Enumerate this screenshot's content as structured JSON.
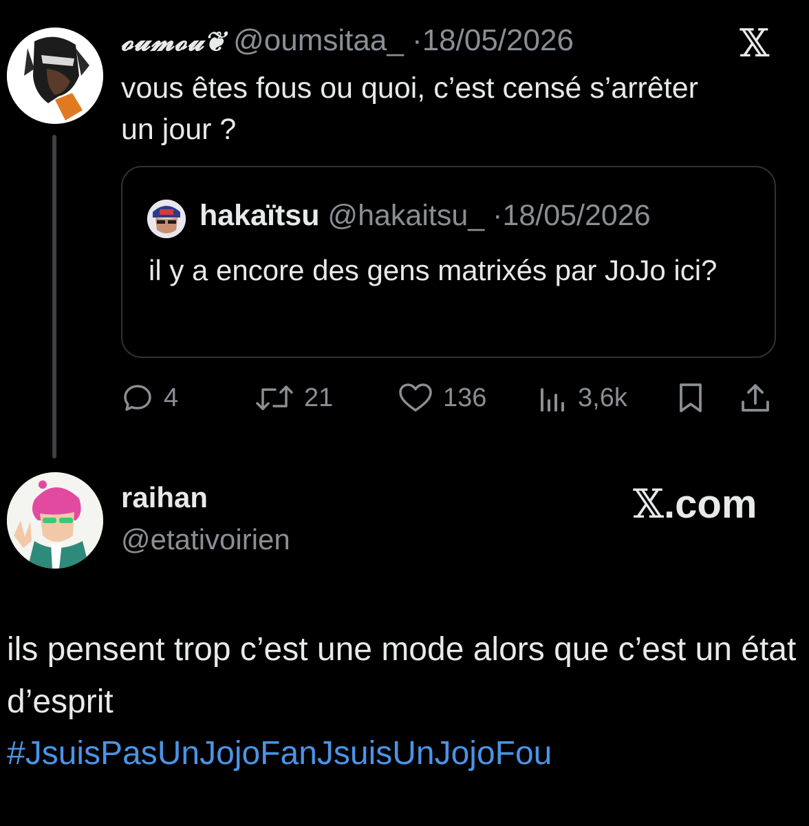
{
  "quoted_by": {
    "display_name": "𝓸𝓾𝓶𝓸𝓾❦",
    "handle": "@oumsitaa_",
    "separator": "·",
    "date": "18/05/2026",
    "text": "vous êtes fous ou quoi, c’est censé s’arrêter un jour ?",
    "stats": {
      "replies": "4",
      "reposts": "21",
      "likes": "136",
      "views": "3,6k"
    }
  },
  "quoted_tweet": {
    "display_name": "hakaïtsu",
    "handle": "@hakaitsu_",
    "separator": "·",
    "date": "18/05/2026",
    "text": "il y a encore des gens matrixés par JoJo ici?"
  },
  "x_logo": "𝕏",
  "reply": {
    "display_name": "raihan",
    "handle": "@etativoirien",
    "text": "ils pensent trop c’est une mode alors que c’est un état d’esprit",
    "hashtag": "#JsuisPasUnJojoFanJsuisUnJojoFou"
  },
  "brand": {
    "mark": "𝕏",
    "suffix": ".com"
  },
  "colors": {
    "background": "#000000",
    "text": "#e7e9ea",
    "muted": "#8b8f94",
    "link": "#4a94e6",
    "border": "#2f3336"
  },
  "icons": {
    "reply": "comment-icon",
    "repost": "repost-icon",
    "like": "heart-icon",
    "views": "analytics-icon",
    "bookmark": "bookmark-icon",
    "share": "share-icon"
  }
}
